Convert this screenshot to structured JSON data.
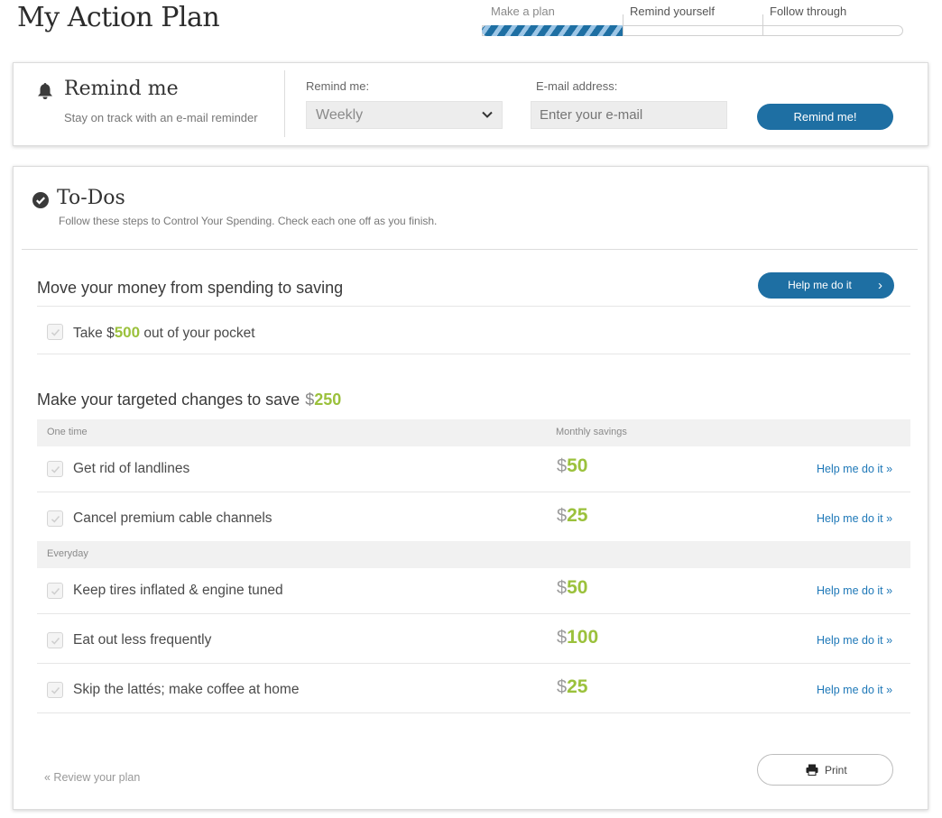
{
  "page_title": "My Action Plan",
  "steps": {
    "items": [
      "Make a plan",
      "Remind yourself",
      "Follow through"
    ],
    "progress_fraction": 0.333
  },
  "remind": {
    "title": "Remind me",
    "subtitle": "Stay on track with an e-mail reminder",
    "frequency_label": "Remind me:",
    "frequency_value": "Weekly",
    "email_label": "E-mail address:",
    "email_placeholder": "Enter your e-mail",
    "button": "Remind me!"
  },
  "todos": {
    "title": "To-Dos",
    "subtitle": "Follow these steps to Control Your Spending. Check each one off as you finish.",
    "section1": {
      "title": "Move your money from spending to saving",
      "help_button": "Help me do it",
      "item_prefix": "Take ",
      "item_dollar": "$",
      "item_amount": "500",
      "item_suffix": " out of your pocket"
    },
    "section2": {
      "title_prefix": "Make your targeted changes to save",
      "dollar": "$",
      "amount": "250",
      "col_one_time": "One time",
      "col_monthly": "Monthly savings",
      "group_everyday": "Everyday",
      "rows": [
        {
          "label": "Get rid of landlines",
          "dollar": "$",
          "amount": "50",
          "link": "Help me do it »"
        },
        {
          "label": "Cancel premium cable channels",
          "dollar": "$",
          "amount": "25",
          "link": "Help me do it »"
        },
        {
          "label": "Keep tires inflated & engine tuned",
          "dollar": "$",
          "amount": "50",
          "link": "Help me do it »"
        },
        {
          "label": "Eat out less frequently",
          "dollar": "$",
          "amount": "100",
          "link": "Help me do it »"
        },
        {
          "label": "Skip the lattés; make coffee at home",
          "dollar": "$",
          "amount": "25",
          "link": "Help me do it »"
        }
      ]
    },
    "review_link": "« Review your plan",
    "print_button": "Print"
  },
  "colors": {
    "accent_blue": "#1e6fa3",
    "money_green": "#9bc13c",
    "link_blue": "#1e78b8"
  },
  "icons": {
    "bell": "bell-icon",
    "check": "check-circle-icon",
    "chevron": "chevron-down-icon",
    "print": "printer-icon"
  }
}
